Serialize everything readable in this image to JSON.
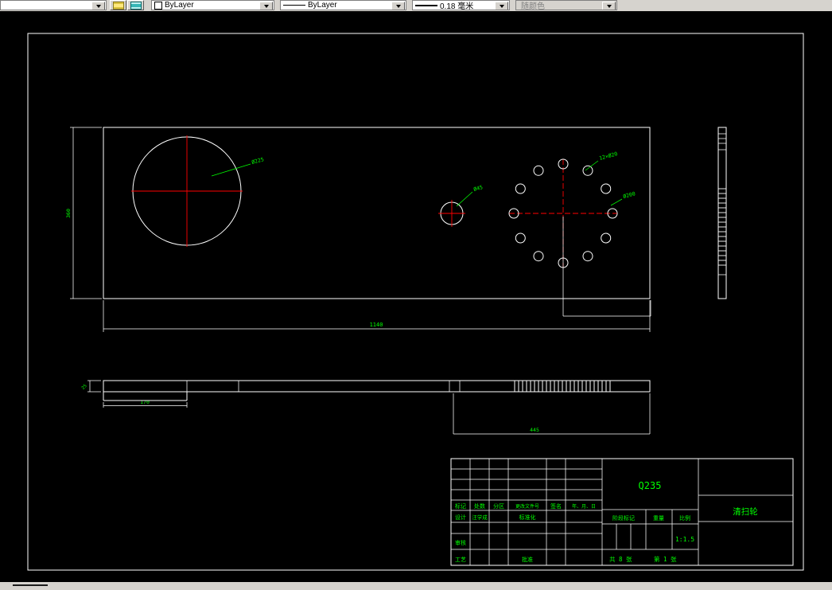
{
  "toolbar": {
    "layer_value": "",
    "color": "ByLayer",
    "linetype": "ByLayer",
    "lineweight": "0.18 毫米",
    "plot_style": "随颜色"
  },
  "drawing": {
    "dimensions": {
      "overall_length": "1140",
      "overall_height": "360",
      "step_width": "170",
      "hub_width": "445",
      "thickness": "25"
    },
    "callouts": {
      "large_hole": "Ø225",
      "small_hole": "Ø45",
      "bolt_holes": "12×Ø20",
      "bolt_circle": "Ø200"
    },
    "title_block": {
      "mark": "标记",
      "count": "处数",
      "zone": "分区",
      "change_no": "更改文件号",
      "sign": "签名",
      "date": "年、月、日",
      "design": "设计",
      "designer": "汪学成",
      "standardization": "标准化",
      "check": "审核",
      "process": "工艺",
      "approve": "批准",
      "material": "Q235",
      "stage_mark": "阶段标记",
      "weight": "重量",
      "scale_label": "比例",
      "scale_value": "1:1.5",
      "sheet_total": "共 8 张",
      "sheet_number": "第 1 张",
      "part_name": "清扫轮"
    }
  }
}
